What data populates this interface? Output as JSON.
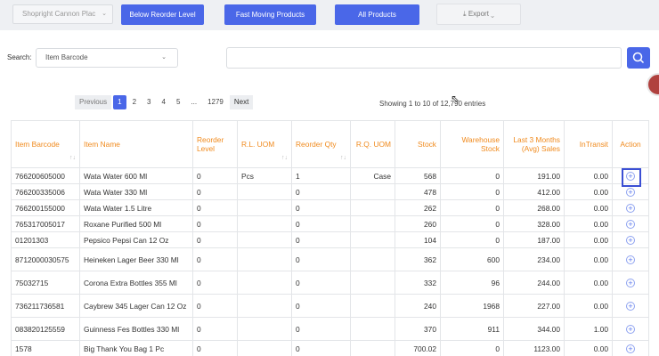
{
  "toolbar": {
    "store": "Shopright Cannon Plac",
    "buttons": [
      "Below Reorder Level",
      "Fast Moving Products",
      "All Products"
    ],
    "export": "Export"
  },
  "search": {
    "label": "Search:",
    "field": "Item Barcode",
    "query": ""
  },
  "pagination": {
    "prev": "Previous",
    "pages": [
      "1",
      "2",
      "3",
      "4",
      "5",
      "...",
      "1279"
    ],
    "next": "Next",
    "current": "1",
    "entries": "Showing 1 to 10 of 12,790 entries"
  },
  "table": {
    "headers": [
      "Item Barcode",
      "Item Name",
      "Reorder Level",
      "R.L. UOM",
      "Reorder Qty",
      "R.Q. UOM",
      "Stock",
      "Warehouse Stock",
      "Last 3 Months (Avg) Sales",
      "InTransit",
      "Action"
    ],
    "rows": [
      [
        "766200605000",
        "Wata Water 600 Ml",
        "0",
        "Pcs",
        "1",
        "Case",
        "568",
        "0",
        "191.00",
        "0.00"
      ],
      [
        "766200335006",
        "Wata Water 330 Ml",
        "0",
        "",
        "0",
        "",
        "478",
        "0",
        "412.00",
        "0.00"
      ],
      [
        "766200155000",
        "Wata Water 1.5 Litre",
        "0",
        "",
        "0",
        "",
        "262",
        "0",
        "268.00",
        "0.00"
      ],
      [
        "765317005017",
        "Roxane Purified 500 Ml",
        "0",
        "",
        "0",
        "",
        "260",
        "0",
        "328.00",
        "0.00"
      ],
      [
        "01201303",
        "Pepsico Pepsi Can 12 Oz",
        "0",
        "",
        "0",
        "",
        "104",
        "0",
        "187.00",
        "0.00"
      ],
      [
        "8712000030575",
        "Heineken Lager Beer 330 Ml",
        "0",
        "",
        "0",
        "",
        "362",
        "600",
        "234.00",
        "0.00"
      ],
      [
        "75032715",
        "Corona Extra Bottles 355 Ml",
        "0",
        "",
        "0",
        "",
        "332",
        "96",
        "244.00",
        "0.00"
      ],
      [
        "736211736581",
        "Caybrew 345 Lager Can 12 Oz",
        "0",
        "",
        "0",
        "",
        "240",
        "1968",
        "227.00",
        "0.00"
      ],
      [
        "083820125559",
        "Guinness Fes Bottles 330 Ml",
        "0",
        "",
        "0",
        "",
        "370",
        "911",
        "344.00",
        "1.00"
      ],
      [
        "1578",
        "Big Thank You Bag 1 Pc",
        "0",
        "",
        "0",
        "",
        "700.02",
        "0",
        "1123.00",
        "0.00"
      ]
    ]
  }
}
